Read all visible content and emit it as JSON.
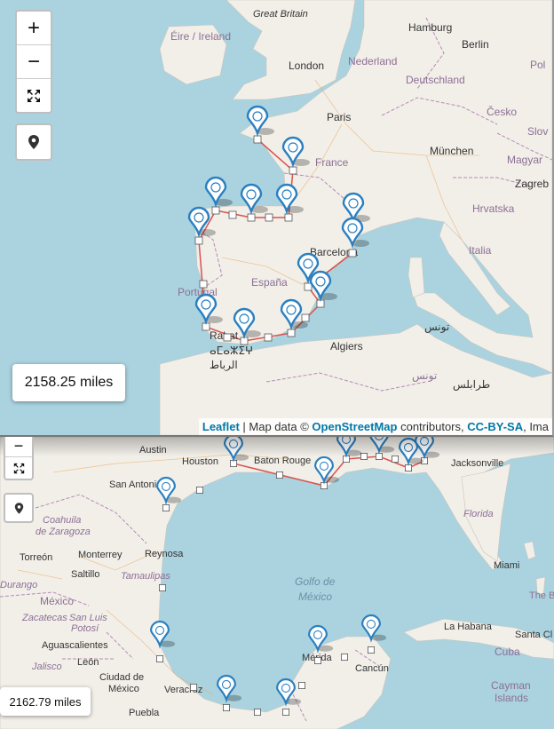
{
  "top_map": {
    "zoom_in_label": "+",
    "zoom_out_label": "−",
    "distance": "2158.25 miles",
    "attribution": {
      "leaflet": "Leaflet",
      "sep1": " | Map data © ",
      "osm": "OpenStreetMap",
      "contrib": " contributors, ",
      "license": "CC-BY-SA",
      "imagery": ", Ima"
    },
    "places": [
      {
        "name": "Great Britain",
        "style": "italic"
      },
      {
        "name": "Éire / Ireland",
        "style": "country"
      },
      {
        "name": "London",
        "style": "city"
      },
      {
        "name": "Nederland",
        "style": "country"
      },
      {
        "name": "Hamburg",
        "style": "city"
      },
      {
        "name": "Berlin",
        "style": "city"
      },
      {
        "name": "Deutschland",
        "style": "country"
      },
      {
        "name": "Pol",
        "style": "country"
      },
      {
        "name": "Paris",
        "style": "city"
      },
      {
        "name": "Česko",
        "style": "country"
      },
      {
        "name": "Slov",
        "style": "country"
      },
      {
        "name": "France",
        "style": "country"
      },
      {
        "name": "München",
        "style": "city"
      },
      {
        "name": "Magyar",
        "style": "country"
      },
      {
        "name": "Zagreb",
        "style": "city"
      },
      {
        "name": "Hrvatska",
        "style": "country"
      },
      {
        "name": "Italia",
        "style": "country"
      },
      {
        "name": "Barcelona",
        "style": "city"
      },
      {
        "name": "España",
        "style": "country"
      },
      {
        "name": "Portugal",
        "style": "country"
      },
      {
        "name": "Rabat",
        "style": "city"
      },
      {
        "name": "ⴰⵎⴰⵣⵉⵖ",
        "style": "city"
      },
      {
        "name": "الرباط",
        "style": "city"
      },
      {
        "name": "Algiers",
        "style": "city"
      },
      {
        "name": "تونس",
        "style": "city"
      },
      {
        "name": "تونس",
        "style": "country"
      },
      {
        "name": "طرابلس",
        "style": "city"
      }
    ]
  },
  "bottom_map": {
    "zoom_out_label": "−",
    "distance": "2162.79 miles",
    "places": [
      {
        "name": "Austin",
        "style": "city"
      },
      {
        "name": "Houston",
        "style": "city"
      },
      {
        "name": "Baton Rouge",
        "style": "city"
      },
      {
        "name": "Jacksonville",
        "style": "city"
      },
      {
        "name": "San Antonio",
        "style": "city"
      },
      {
        "name": "Florida",
        "style": "region"
      },
      {
        "name": "Coahuila",
        "style": "region"
      },
      {
        "name": "de Zaragoza",
        "style": "region"
      },
      {
        "name": "Torreón",
        "style": "city"
      },
      {
        "name": "Monterrey",
        "style": "city"
      },
      {
        "name": "Reynosa",
        "style": "city"
      },
      {
        "name": "Saltillo",
        "style": "city"
      },
      {
        "name": "Tamaulipas",
        "style": "region"
      },
      {
        "name": "Durango",
        "style": "region"
      },
      {
        "name": "Miami",
        "style": "city"
      },
      {
        "name": "Golfo de",
        "style": "sea"
      },
      {
        "name": "México",
        "style": "sea"
      },
      {
        "name": "The B",
        "style": "country"
      },
      {
        "name": "México",
        "style": "country"
      },
      {
        "name": "Zacatecas",
        "style": "region"
      },
      {
        "name": "San Luis",
        "style": "region"
      },
      {
        "name": "Potosí",
        "style": "region"
      },
      {
        "name": "La Habana",
        "style": "city"
      },
      {
        "name": "Santa Cl",
        "style": "city"
      },
      {
        "name": "Aguascalientes",
        "style": "city"
      },
      {
        "name": "Cuba",
        "style": "country"
      },
      {
        "name": "Jalisco",
        "style": "region"
      },
      {
        "name": "León",
        "style": "city"
      },
      {
        "name": "Mérida",
        "style": "city"
      },
      {
        "name": "Cancún",
        "style": "city"
      },
      {
        "name": "Ciudad de",
        "style": "city"
      },
      {
        "name": "México",
        "style": "city"
      },
      {
        "name": "Veracruz",
        "style": "city"
      },
      {
        "name": "Puebla",
        "style": "city"
      },
      {
        "name": "Cayman",
        "style": "country"
      },
      {
        "name": "Islands",
        "style": "country"
      }
    ]
  },
  "colors": {
    "water": "#aad3df",
    "land": "#f2efe9",
    "route": "#d9534f",
    "marker": "#2a7fc1",
    "border": "#b58ab8"
  },
  "icons": [
    "plus-icon",
    "minus-icon",
    "fullscreen-icon",
    "map-pin-icon",
    "location-marker-icon",
    "waypoint-icon"
  ]
}
